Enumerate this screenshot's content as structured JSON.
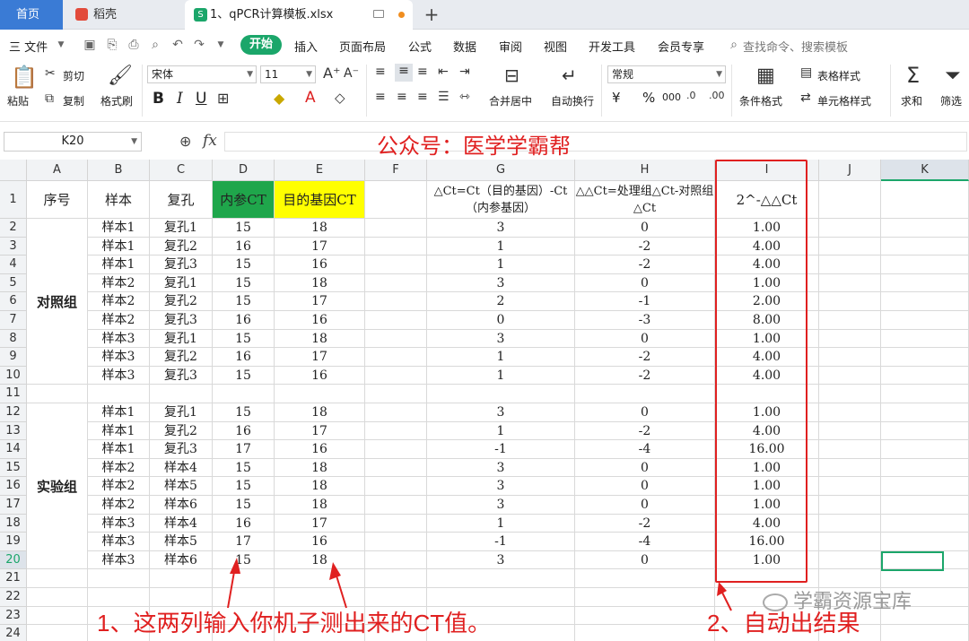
{
  "tabs": {
    "home": "首页",
    "daoke": "稻壳",
    "file": "1、qPCR计算模板.xlsx",
    "add": "+"
  },
  "menu": {
    "file": "三 文件",
    "items": [
      "开始",
      "插入",
      "页面布局",
      "公式",
      "数据",
      "审阅",
      "视图",
      "开发工具",
      "会员专享"
    ],
    "search": "查找命令、搜索模板"
  },
  "ribbon": {
    "paste": "粘贴",
    "cut": "剪切",
    "copy": "复制",
    "format_painter": "格式刷",
    "font_name": "宋体",
    "font_size": "11",
    "bold": "B",
    "italic": "I",
    "underline": "U",
    "merge_center": "合并居中",
    "wrap": "自动换行",
    "number_format": "常规",
    "currency": "¥",
    "percent": "%",
    "thousands": "000",
    "cond_format": "条件格式",
    "table_style": "表格样式",
    "cell_style": "单元格样式",
    "sum": "求和",
    "filter": "筛选"
  },
  "formula_bar": {
    "cell_ref": "K20",
    "fx": "fx",
    "value": ""
  },
  "overlay_title": "公众号：医学学霸帮",
  "columns": [
    "A",
    "B",
    "C",
    "D",
    "E",
    "F",
    "G",
    "H",
    "I",
    "J",
    "K"
  ],
  "row_numbers": [
    "1",
    "2",
    "3",
    "4",
    "5",
    "6",
    "7",
    "8",
    "9",
    "10",
    "11",
    "12",
    "13",
    "14",
    "15",
    "16",
    "17",
    "18",
    "19",
    "20",
    "21",
    "22",
    "23",
    "24"
  ],
  "header_row": {
    "a": "序号",
    "b": "样本",
    "c": "复孔",
    "d": "内参CT",
    "e": "目的基因CT",
    "g": "△Ct=Ct（目的基因）-Ct（内参基因）",
    "h": "△△Ct=处理组△Ct-对照组△Ct",
    "i": "2^-△△Ct"
  },
  "header_colors": {
    "d_fill": "#1fa64b",
    "e_fill": "#ffff00"
  },
  "groups": {
    "control": "对照组",
    "experiment": "实验组"
  },
  "rows": [
    [
      "样本1",
      "复孔1",
      "15",
      "18",
      "3",
      "0",
      "1.00"
    ],
    [
      "样本1",
      "复孔2",
      "16",
      "17",
      "1",
      "-2",
      "4.00"
    ],
    [
      "样本1",
      "复孔3",
      "15",
      "16",
      "1",
      "-2",
      "4.00"
    ],
    [
      "样本2",
      "复孔1",
      "15",
      "18",
      "3",
      "0",
      "1.00"
    ],
    [
      "样本2",
      "复孔2",
      "15",
      "17",
      "2",
      "-1",
      "2.00"
    ],
    [
      "样本2",
      "复孔3",
      "16",
      "16",
      "0",
      "-3",
      "8.00"
    ],
    [
      "样本3",
      "复孔1",
      "15",
      "18",
      "3",
      "0",
      "1.00"
    ],
    [
      "样本3",
      "复孔2",
      "16",
      "17",
      "1",
      "-2",
      "4.00"
    ],
    [
      "样本3",
      "复孔3",
      "15",
      "16",
      "1",
      "-2",
      "4.00"
    ],
    [
      "",
      "",
      "",
      "",
      "",
      "",
      ""
    ],
    [
      "样本1",
      "复孔1",
      "15",
      "18",
      "3",
      "0",
      "1.00"
    ],
    [
      "样本1",
      "复孔2",
      "16",
      "17",
      "1",
      "-2",
      "4.00"
    ],
    [
      "样本1",
      "复孔3",
      "17",
      "16",
      "-1",
      "-4",
      "16.00"
    ],
    [
      "样本2",
      "样本4",
      "15",
      "18",
      "3",
      "0",
      "1.00"
    ],
    [
      "样本2",
      "样本5",
      "15",
      "18",
      "3",
      "0",
      "1.00"
    ],
    [
      "样本2",
      "样本6",
      "15",
      "18",
      "3",
      "0",
      "1.00"
    ],
    [
      "样本3",
      "样本4",
      "16",
      "17",
      "1",
      "-2",
      "4.00"
    ],
    [
      "样本3",
      "样本5",
      "17",
      "16",
      "-1",
      "-4",
      "16.00"
    ],
    [
      "样本3",
      "样本6",
      "15",
      "18",
      "3",
      "0",
      "1.00"
    ]
  ],
  "annotations": {
    "note1": "1、这两列输入你机子测出来的CT值。",
    "note2": "2、自动出结果",
    "watermark": "学霸资源宝库"
  },
  "colors": {
    "accent": "#1ba66a",
    "annotation": "#e02020",
    "home_tab": "#3a7bd5"
  }
}
